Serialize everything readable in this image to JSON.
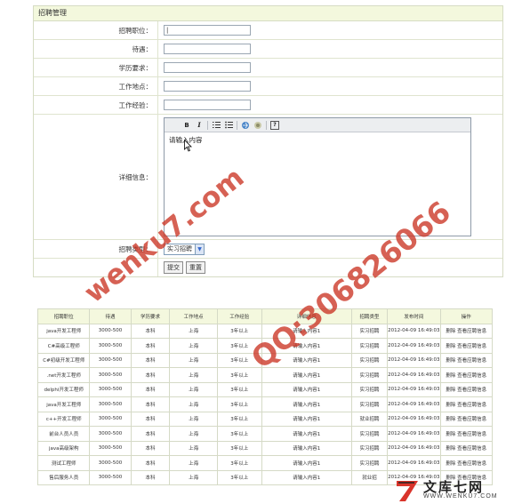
{
  "panel": {
    "title": "招聘管理"
  },
  "form": {
    "position_label": "招聘职位：",
    "salary_label": "待遇：",
    "education_label": "学历要求：",
    "location_label": "工作地点：",
    "experience_label": "工作经验：",
    "detail_label": "详细信息：",
    "type_label": "招聘类型：",
    "editor_text": "请输入内容",
    "type_selected": "实习招聘",
    "submit_label": "提交",
    "reset_label": "重置"
  },
  "editor_toolbar": {
    "bold": "B",
    "italic": "I",
    "help": "?"
  },
  "table": {
    "headers": [
      "招聘职位",
      "待遇",
      "学历要求",
      "工作地点",
      "工作经验",
      "详细信息",
      "招聘类型",
      "发布时间",
      "操作"
    ],
    "rows": [
      [
        "java开发工程师",
        "3000-500",
        "本科",
        "上海",
        "3年以上",
        "请输入内容1",
        "实习招聘",
        "2012-04-09 16:49:03",
        "删除 查看应聘信息"
      ],
      [
        "C#高级工程师",
        "3000-500",
        "本科",
        "上海",
        "3年以上",
        "请输入内容1",
        "实习招聘",
        "2012-04-09 16:49:03",
        "删除 查看应聘信息"
      ],
      [
        "C#初级开发工程师",
        "3000-500",
        "本科",
        "上海",
        "3年以上",
        "请输入内容1",
        "实习招聘",
        "2012-04-09 16:49:03",
        "删除 查看应聘信息"
      ],
      [
        ".net开发工程师",
        "3000-500",
        "本科",
        "上海",
        "3年以上",
        "请输入内容1",
        "实习招聘",
        "2012-04-09 16:49:03",
        "删除 查看应聘信息"
      ],
      [
        "delphi开发工程师",
        "3000-500",
        "本科",
        "上海",
        "3年以上",
        "请输入内容1",
        "实习招聘",
        "2012-04-09 16:49:03",
        "删除 查看应聘信息"
      ],
      [
        "java开发工程师",
        "3000-500",
        "本科",
        "上海",
        "3年以上",
        "请输入内容1",
        "实习招聘",
        "2012-04-09 16:49:03",
        "删除 查看应聘信息"
      ],
      [
        "c++开发工程师",
        "3000-500",
        "本科",
        "上海",
        "3年以上",
        "请输入内容1",
        "就业招聘",
        "2012-04-09 16:49:03",
        "删除 查看应聘信息"
      ],
      [
        "前台人员人员",
        "3000-500",
        "本科",
        "上海",
        "3年以上",
        "请输入内容1",
        "实习招聘",
        "2012-04-09 16:49:03",
        "删除 查看应聘信息"
      ],
      [
        "java高级架构",
        "3000-500",
        "本科",
        "上海",
        "3年以上",
        "请输入内容1",
        "实习招聘",
        "2012-04-09 16:49:03",
        "删除 查看应聘信息"
      ],
      [
        "测试工程师",
        "3000-500",
        "本科",
        "上海",
        "3年以上",
        "请输入内容1",
        "实习招聘",
        "2012-04-09 16:49:03",
        "删除 查看应聘信息"
      ],
      [
        "售后服务人员",
        "3000-500",
        "本科",
        "上海",
        "3年以上",
        "请输入内容1",
        "就业招",
        "2012-04-09 16:49:03",
        "删除 查看应聘信息"
      ]
    ]
  },
  "watermarks": {
    "site": "wenku7.com",
    "qq": "QQ:306826066"
  },
  "footer_logo": {
    "cn": "文库七网",
    "url": "WWW.WENKU7.COM"
  },
  "colors": {
    "panel_head": "#f3f8dd",
    "watermark": "#cc3a2a",
    "border": "#d6dcc4"
  }
}
